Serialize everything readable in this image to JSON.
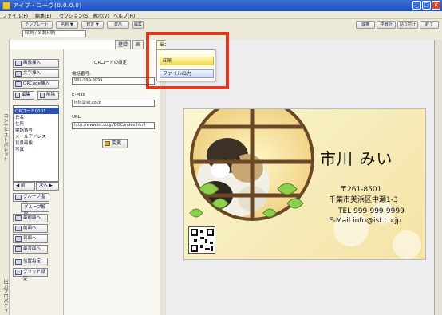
{
  "window": {
    "title": "アイブ・コーヴ(0.0.0.0)",
    "min_label": "_",
    "max_label": "□",
    "close_label": "×"
  },
  "menu": [
    {
      "label": "ファイル(F)"
    },
    {
      "label": "編集(E)"
    },
    {
      "label": "セクション(S)"
    },
    {
      "label": "表示(V)"
    },
    {
      "label": "ヘルプ(H)"
    }
  ],
  "toolbar": {
    "left_buttons": [
      "テンプレート",
      "名刺 ▼",
      "修正 ▼",
      "表示",
      "編集"
    ],
    "right_buttons": [
      "縦横",
      "枠選択",
      "貼り付け",
      "終了"
    ]
  },
  "path": "印刷 / 名刺印刷",
  "tabs": [
    {
      "label": "登録"
    },
    {
      "label": "画"
    },
    {
      "label": "出力"
    }
  ],
  "dropdown": {
    "items": [
      {
        "label": "印刷"
      },
      {
        "label": "ファイル出力"
      }
    ]
  },
  "sidebar": {
    "vertical_label_top": "コンテキストパレット",
    "vertical_label_bottom": "出力プロパティ"
  },
  "tools": {
    "image_insert": "画像挿入",
    "text_insert": "文字挿入",
    "qr_insert": "QRCode挿入",
    "edit": "編集",
    "delete": "削除",
    "object_list": [
      {
        "label": "QRコード0001",
        "selected": true
      },
      {
        "label": "氏名"
      },
      {
        "label": "住所"
      },
      {
        "label": "電話番号"
      },
      {
        "label": "メールアドレス"
      },
      {
        "label": "背景画像"
      },
      {
        "label": "写真"
      }
    ],
    "prev": "◀ 前",
    "next": "次へ ▶",
    "group_label": "グループ指定",
    "group_clear": "グループ解除",
    "front_all": "最前面へ",
    "front": "前面へ",
    "back": "背面へ",
    "back_all": "最背面へ",
    "align": "位置指定",
    "grid": "グリッド設定"
  },
  "properties": {
    "heading": "QRコードの設定",
    "phone_label": "電話番号:",
    "phone_value": "999-999-9999",
    "email_label": "E-Mail",
    "email_value": "info@ist.co.jp",
    "url_label": "URL:",
    "url_value": "http://www.ist.co.jp/DOC/index.html",
    "exec_button": "変更"
  },
  "card": {
    "name": "市川 みい",
    "postal": "〒261-8501",
    "address": "千葉市美浜区中瀬1-3",
    "tel": "TEL 999-999-9999",
    "email": "E-Mail info@ist.co.jp"
  },
  "colors": {
    "highlight": "#e0391f",
    "title_bar": "#1f4fbf",
    "card_bg": "#f7edbc",
    "selected_row": "#2b4fb5"
  }
}
